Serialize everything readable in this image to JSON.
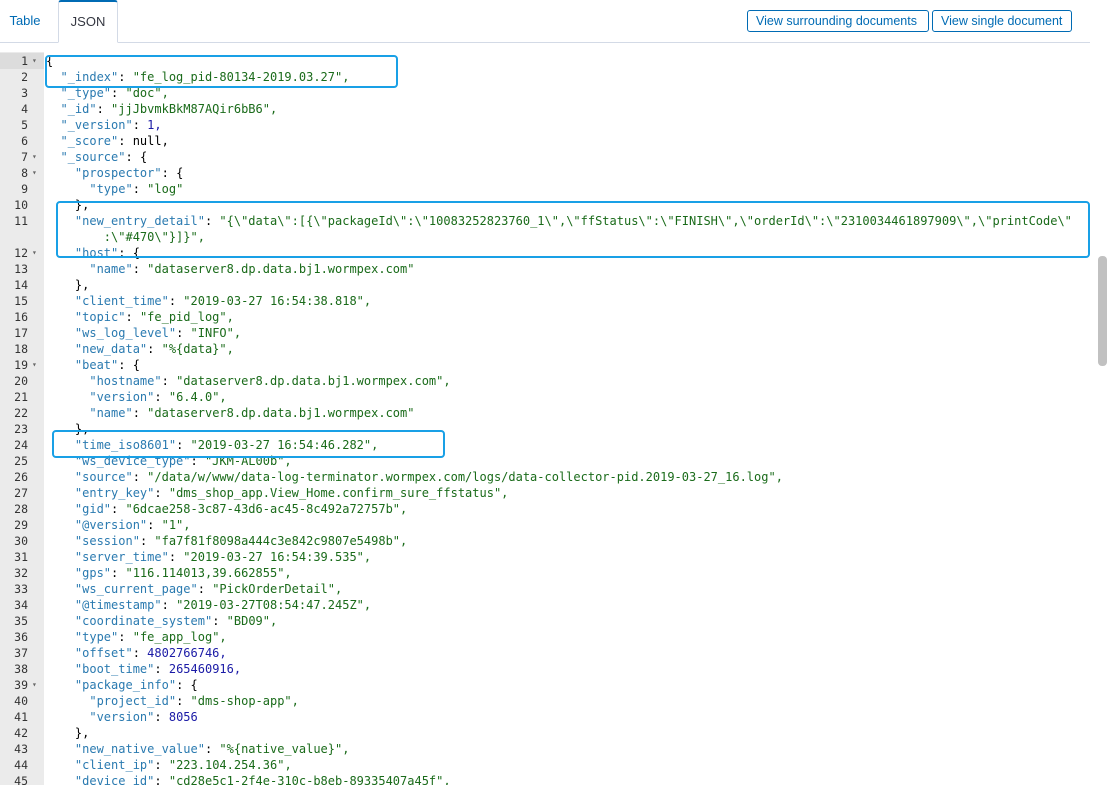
{
  "tabs": [
    {
      "label": "Table"
    },
    {
      "label": "JSON"
    }
  ],
  "buttons": {
    "surrounding": "View surrounding documents",
    "single": "View single document"
  },
  "lines": [
    {
      "n": "1",
      "fold": true,
      "t": "{"
    },
    {
      "n": "2",
      "t": "  \"_index\": \"fe_log_pid-80134-2019.03.27\","
    },
    {
      "n": "3",
      "t": "  \"_type\": \"doc\","
    },
    {
      "n": "4",
      "t": "  \"_id\": \"jjJbvmkBkM87AQir6bB6\","
    },
    {
      "n": "5",
      "t": "  \"_version\": 1,"
    },
    {
      "n": "6",
      "t": "  \"_score\": null,"
    },
    {
      "n": "7",
      "fold": true,
      "t": "  \"_source\": {"
    },
    {
      "n": "8",
      "fold": true,
      "t": "    \"prospector\": {"
    },
    {
      "n": "9",
      "t": "      \"type\": \"log\""
    },
    {
      "n": "10",
      "t": "    },"
    },
    {
      "n": "11",
      "t": "    \"new_entry_detail\": \"{\\\"data\\\":[{\\\"packageId\\\":\\\"10083252823760_1\\\",\\\"ffStatus\\\":\\\"FINISH\\\",\\\"orderId\\\":\\\"2310034461897909\\\",\\\"printCode\\\""
    },
    {
      "n": "",
      "t": "        :\\\"#470\\\"}]}\","
    },
    {
      "n": "12",
      "fold": true,
      "t": "    \"host\": {"
    },
    {
      "n": "13",
      "t": "      \"name\": \"dataserver8.dp.data.bj1.wormpex.com\""
    },
    {
      "n": "14",
      "t": "    },"
    },
    {
      "n": "15",
      "t": "    \"client_time\": \"2019-03-27 16:54:38.818\","
    },
    {
      "n": "16",
      "t": "    \"topic\": \"fe_pid_log\","
    },
    {
      "n": "17",
      "t": "    \"ws_log_level\": \"INFO\","
    },
    {
      "n": "18",
      "t": "    \"new_data\": \"%{data}\","
    },
    {
      "n": "19",
      "fold": true,
      "t": "    \"beat\": {"
    },
    {
      "n": "20",
      "t": "      \"hostname\": \"dataserver8.dp.data.bj1.wormpex.com\","
    },
    {
      "n": "21",
      "t": "      \"version\": \"6.4.0\","
    },
    {
      "n": "22",
      "t": "      \"name\": \"dataserver8.dp.data.bj1.wormpex.com\""
    },
    {
      "n": "23",
      "t": "    },"
    },
    {
      "n": "24",
      "t": "    \"time_iso8601\": \"2019-03-27 16:54:46.282\","
    },
    {
      "n": "25",
      "t": "    \"ws_device_type\": \"JKM-AL00b\","
    },
    {
      "n": "26",
      "t": "    \"source\": \"/data/w/www/data-log-terminator.wormpex.com/logs/data-collector-pid.2019-03-27_16.log\","
    },
    {
      "n": "27",
      "t": "    \"entry_key\": \"dms_shop_app.View_Home.confirm_sure_ffstatus\","
    },
    {
      "n": "28",
      "t": "    \"gid\": \"6dcae258-3c87-43d6-ac45-8c492a72757b\","
    },
    {
      "n": "29",
      "t": "    \"@version\": \"1\","
    },
    {
      "n": "30",
      "t": "    \"session\": \"fa7f81f8098a444c3e842c9807e5498b\","
    },
    {
      "n": "31",
      "t": "    \"server_time\": \"2019-03-27 16:54:39.535\","
    },
    {
      "n": "32",
      "t": "    \"gps\": \"116.114013,39.662855\","
    },
    {
      "n": "33",
      "t": "    \"ws_current_page\": \"PickOrderDetail\","
    },
    {
      "n": "34",
      "t": "    \"@timestamp\": \"2019-03-27T08:54:47.245Z\","
    },
    {
      "n": "35",
      "t": "    \"coordinate_system\": \"BD09\","
    },
    {
      "n": "36",
      "t": "    \"type\": \"fe_app_log\","
    },
    {
      "n": "37",
      "t": "    \"offset\": 4802766746,"
    },
    {
      "n": "38",
      "t": "    \"boot_time\": 265460916,"
    },
    {
      "n": "39",
      "fold": true,
      "t": "    \"package_info\": {"
    },
    {
      "n": "40",
      "t": "      \"project_id\": \"dms-shop-app\","
    },
    {
      "n": "41",
      "t": "      \"version\": 8056"
    },
    {
      "n": "42",
      "t": "    },"
    },
    {
      "n": "43",
      "t": "    \"new_native_value\": \"%{native_value}\","
    },
    {
      "n": "44",
      "t": "    \"client_ip\": \"223.104.254.36\","
    },
    {
      "n": "45",
      "t": "    \"device_id\": \"cd28e5c1-2f4e-310c-b8eb-89335407a45f\","
    }
  ]
}
